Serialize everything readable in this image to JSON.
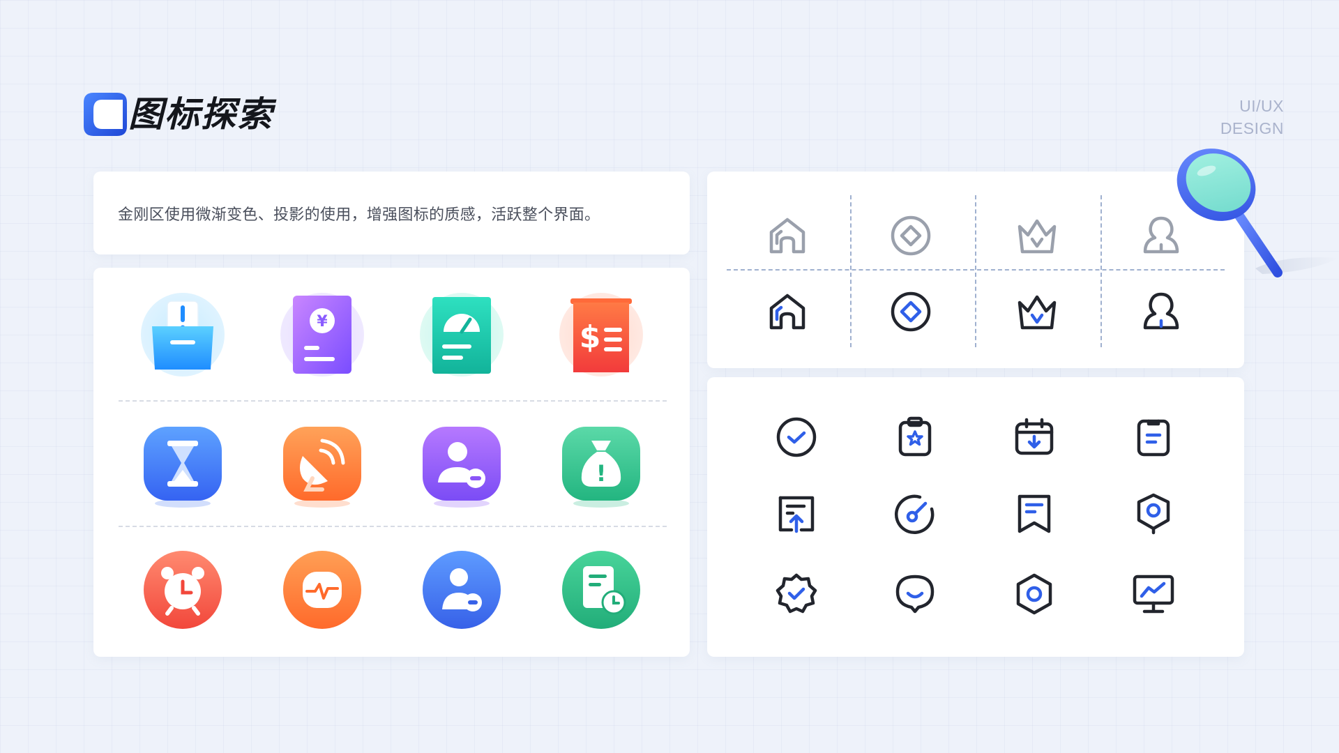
{
  "header": {
    "title": "图标探索",
    "brand_line1": "UI/UX",
    "brand_line2": "DESIGN"
  },
  "description": "金刚区使用微渐变色、投影的使用，增强图标的质感，活跃整个界面。",
  "colors": {
    "accent_blue": "#2f5fe8",
    "outline_gray": "#9aa0ac",
    "stroke_dark": "#22252d",
    "magnifier_lens": "#8ee6da"
  },
  "grad_icons": [
    {
      "name": "inbox-alert-icon"
    },
    {
      "name": "yuan-bill-icon",
      "glyph": "¥"
    },
    {
      "name": "speed-report-icon"
    },
    {
      "name": "dollar-list-icon",
      "glyph": "$"
    },
    {
      "name": "hourglass-icon"
    },
    {
      "name": "satellite-dish-icon"
    },
    {
      "name": "user-remove-icon"
    },
    {
      "name": "money-bag-alert-icon",
      "glyph": "!"
    },
    {
      "name": "alarm-clock-icon"
    },
    {
      "name": "heart-rate-icon"
    },
    {
      "name": "user-minus-icon"
    },
    {
      "name": "document-clock-icon"
    }
  ],
  "compare_icons": [
    {
      "name": "home-icon"
    },
    {
      "name": "diamond-icon"
    },
    {
      "name": "crown-icon"
    },
    {
      "name": "user-icon"
    }
  ],
  "line_icons": [
    {
      "name": "check-circle-icon"
    },
    {
      "name": "clipboard-star-icon"
    },
    {
      "name": "calendar-download-icon"
    },
    {
      "name": "clipboard-list-icon"
    },
    {
      "name": "document-upload-icon"
    },
    {
      "name": "gauge-icon"
    },
    {
      "name": "bookmark-icon"
    },
    {
      "name": "location-badge-icon"
    },
    {
      "name": "verified-badge-icon"
    },
    {
      "name": "chat-smile-icon"
    },
    {
      "name": "hexagon-settings-icon"
    },
    {
      "name": "monitor-chart-icon"
    }
  ]
}
